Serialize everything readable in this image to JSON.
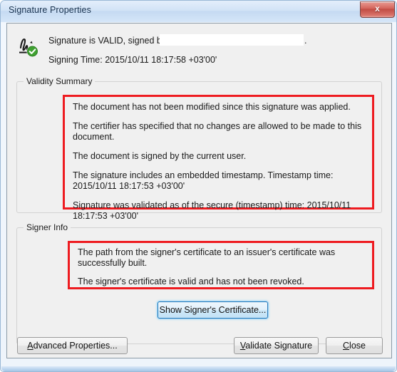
{
  "window": {
    "title": "Signature Properties",
    "close_glyph": "x",
    "close_icon_name": "close-icon"
  },
  "header": {
    "icon_name": "signature-valid-icon",
    "valid_text": "Signature is VALID, signed by",
    "redacted_name": "",
    "valid_text_suffix": ".",
    "signing_time_label": "Signing Time:",
    "signing_time_value": "2015/10/11 18:17:58 +03'00'",
    "signing_time_line": "Signing Time:  2015/10/11 18:17:58 +03'00'"
  },
  "validity_summary": {
    "title": "Validity Summary",
    "items": [
      "The document has not been modified since this signature was applied.",
      "The certifier has specified that no changes are allowed to be made to this document.",
      "The document is signed by the current user.",
      "The signature includes an embedded timestamp. Timestamp time: 2015/10/11 18:17:53 +03'00'",
      "Signature was validated as of the secure (timestamp) time: 2015/10/11 18:17:53 +03'00'"
    ],
    "item0": "The document has not been modified since this signature was applied.",
    "item1": "The certifier has specified that no changes are allowed to be made to this document.",
    "item2": "The document is signed by the current user.",
    "item3": "The signature includes an embedded timestamp. Timestamp time: 2015/10/11 18:17:53 +03'00'",
    "item4": "Signature was validated as of the secure (timestamp) time: 2015/10/11 18:17:53 +03'00'"
  },
  "signer_info": {
    "title": "Signer Info",
    "items": [
      "The path from the signer's certificate to an issuer's certificate was successfully built.",
      "The signer's certificate is valid and has not been revoked."
    ],
    "item0": "The path from the signer's certificate to an issuer's certificate was successfully built.",
    "item1": "The signer's certificate is valid and has not been revoked.",
    "show_certificate_button": "Show Signer's Certificate..."
  },
  "footer": {
    "advanced_properties_button": "Advanced Properties...",
    "advanced_properties_accel": "A",
    "advanced_properties_rest": "dvanced Properties...",
    "validate_signature_button": "Validate Signature",
    "validate_signature_accel": "V",
    "validate_signature_rest": "alidate Signature",
    "close_button": "Close",
    "close_accel": "C",
    "close_rest": "lose"
  },
  "colors": {
    "highlight_red": "#ee1b20",
    "focus_blue": "#2c79b8",
    "check_green": "#3fa130",
    "titlebar_blue": "#cfe0f3",
    "client_bg": "#f0f0f0",
    "close_button_red": "#c14d44"
  }
}
